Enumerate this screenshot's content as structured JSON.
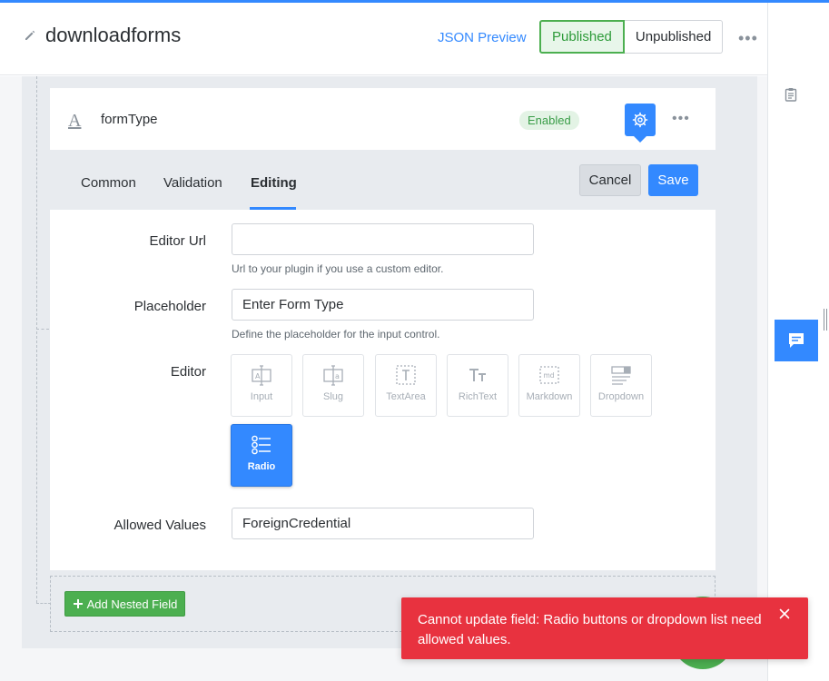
{
  "header": {
    "title": "downloadforms",
    "json_preview": "JSON Preview",
    "published": "Published",
    "unpublished": "Unpublished"
  },
  "field": {
    "name": "formType",
    "status": "Enabled"
  },
  "tabs": [
    {
      "label": "Common",
      "active": false
    },
    {
      "label": "Validation",
      "active": false
    },
    {
      "label": "Editing",
      "active": true
    }
  ],
  "actions": {
    "cancel": "Cancel",
    "save": "Save"
  },
  "form": {
    "editor_url": {
      "label": "Editor Url",
      "value": "",
      "hint": "Url to your plugin if you use a custom editor."
    },
    "placeholder": {
      "label": "Placeholder",
      "value": "Enter Form Type",
      "hint": "Define the placeholder for the input control."
    },
    "editor": {
      "label": "Editor",
      "options": [
        {
          "label": "Input",
          "icon": "input-icon"
        },
        {
          "label": "Slug",
          "icon": "slug-icon"
        },
        {
          "label": "TextArea",
          "icon": "textarea-icon"
        },
        {
          "label": "RichText",
          "icon": "richtext-icon"
        },
        {
          "label": "Markdown",
          "icon": "markdown-icon"
        },
        {
          "label": "Dropdown",
          "icon": "dropdown-icon"
        },
        {
          "label": "Radio",
          "icon": "radio-icon"
        }
      ],
      "selected": "Radio"
    },
    "allowed_values": {
      "label": "Allowed Values",
      "value": "ForeignCredential"
    }
  },
  "nested": {
    "add_label": "Add Nested Field"
  },
  "toast": {
    "message": "Cannot update field: Radio buttons or dropdown list need allowed values."
  },
  "colors": {
    "accent": "#3389ff",
    "success": "#4caf50",
    "error": "#e8323f"
  }
}
